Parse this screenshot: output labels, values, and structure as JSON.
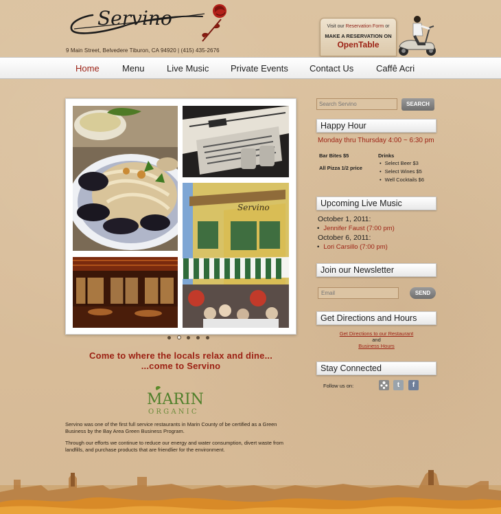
{
  "brand": {
    "logo_text": "Servino",
    "address": "9 Main Street, Belvedere Tiburon, CA 94920  |  (415) 435-2676"
  },
  "reservation": {
    "line1_prefix": "Visit our ",
    "line1_link": "Reservation Form",
    "line1_suffix": " or",
    "line2": "MAKE A RESERVATION  ON",
    "line3": "OpenTable"
  },
  "nav": {
    "items": [
      {
        "label": "Home"
      },
      {
        "label": "Menu"
      },
      {
        "label": "Live Music"
      },
      {
        "label": "Private Events"
      },
      {
        "label": "Contact Us"
      },
      {
        "label": "Caffê Acri"
      }
    ]
  },
  "slideshow": {
    "active_dot": 2,
    "dot_count": 5
  },
  "tagline": {
    "line1": "Come to where the locals relax and dine...",
    "line2": "...come to Servino"
  },
  "marin_logo": {
    "word1": "MARIN",
    "word2": "ORGANIC"
  },
  "about": {
    "para1": "Servino was one of the first full service restaurants in Marin County of be certified as a Green Business by the Bay Area Green Business Program.",
    "para2": "Through our efforts we continue to reduce our energy and water consumption, divert waste from landfills, and purchase products that are friendlier for the environment."
  },
  "search": {
    "placeholder": "Search Servino",
    "button": "SEARCH"
  },
  "happy_hour": {
    "title": "Happy Hour",
    "subtitle": "Monday thru Thursday 4:00 ~ 6:30 pm",
    "food": [
      "Bar Bites $5",
      "All Pizza 1/2 price"
    ],
    "drinks_label": "Drinks",
    "drinks": [
      "Select Beer $3",
      "Select Wines $5",
      "Well Cocktails $6"
    ]
  },
  "live_music": {
    "title": "Upcoming Live Music",
    "events": [
      {
        "date": "October 1, 2011:",
        "act": "Jennifer Faust (7:00 pm)"
      },
      {
        "date": "October 6, 2011:",
        "act": "Lori Carsillo (7:00 pm)"
      }
    ]
  },
  "newsletter": {
    "title": "Join our Newsletter",
    "placeholder": "Email",
    "button": "SEND"
  },
  "directions": {
    "title": "Get Directions and Hours",
    "link1": "Get Directions to our Restaurant",
    "and": "and",
    "link2": "Business Hours"
  },
  "stay_connected": {
    "title": "Stay Connected",
    "follow_label": "Follow us on:",
    "icons": [
      "yelp-icon",
      "twitter-icon",
      "facebook-icon"
    ]
  },
  "colors": {
    "accent": "#9b1f12",
    "background": "#d9bf9c"
  }
}
